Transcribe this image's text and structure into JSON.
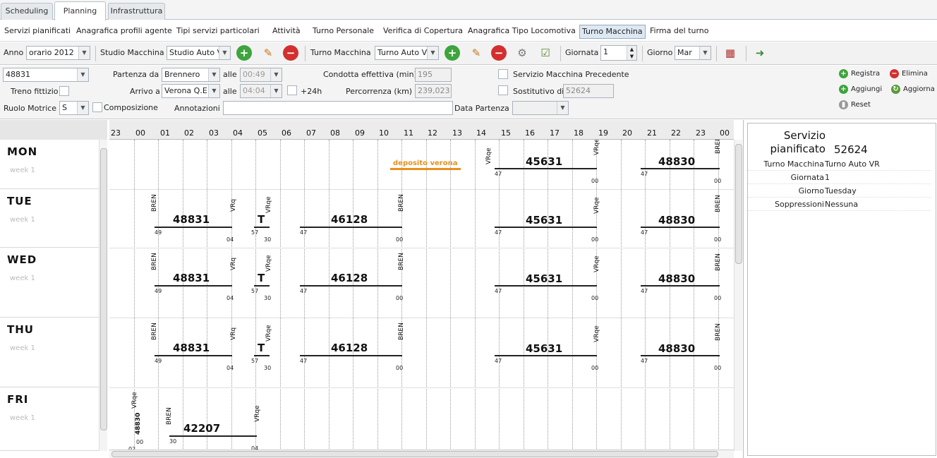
{
  "tabs": [
    "Scheduling",
    "Planning",
    "Infrastruttura"
  ],
  "menu": [
    "Servizi pianificati",
    "Anagrafica profili agente",
    "Tipi servizi particolari",
    "Attività",
    "Turno Personale",
    "Verifica di Copertura",
    "Anagrafica Tipo Locomotiva",
    "Turno Macchina",
    "Firma del turno"
  ],
  "toolbar": {
    "anno_label": "Anno",
    "anno_value": "orario 2012",
    "studio_label": "Studio Macchina",
    "studio_value": "Studio Auto V",
    "turno_label": "Turno Macchina",
    "turno_value": "Turno Auto V",
    "giornata_label": "Giornata",
    "giornata_value": "1",
    "giorno_label": "Giorno",
    "giorno_value": "Mar"
  },
  "form": {
    "train_value": "48831",
    "partenza_label": "Partenza da",
    "partenza_value": "Brennero",
    "alle1_label": "alle",
    "alle1_value": "00:49",
    "condotta_label": "Condotta effettiva (min)",
    "condotta_value": "195",
    "smp_label": "Servizio Macchina Precedente",
    "fittizio_label": "Treno fittizio",
    "arrivo_label": "Arrivo a",
    "arrivo_value": "Verona Q.E",
    "alle2_label": "alle",
    "alle2_value": "04:04",
    "plus24_label": "+24h",
    "percorrenza_label": "Percorrenza (km)",
    "percorrenza_value": "239,023",
    "sostitutivo_label": "Sostitutivo di",
    "sostitutivo_value": "52624",
    "ruolo_label": "Ruolo Motrice",
    "ruolo_value": "S",
    "composizione_label": "Composizione",
    "annotazioni_label": "Annotazioni",
    "annotazioni_value": "",
    "data_partenza_label": "Data Partenza",
    "data_partenza_value": ""
  },
  "actions": {
    "registra": "Registra",
    "elimina": "Elimina",
    "aggiungi": "Aggiungi",
    "aggiorna": "Aggiorna",
    "reset": "Reset"
  },
  "hours": [
    "23",
    "00",
    "01",
    "02",
    "03",
    "04",
    "05",
    "06",
    "07",
    "08",
    "09",
    "10",
    "11",
    "12",
    "13",
    "14",
    "15",
    "16",
    "17",
    "18",
    "19",
    "20",
    "21",
    "22",
    "23",
    "00"
  ],
  "days": [
    {
      "name": "MON",
      "week": "week 1"
    },
    {
      "name": "TUE",
      "week": "week 1"
    },
    {
      "name": "WED",
      "week": "week 1"
    },
    {
      "name": "THU",
      "week": "week 1"
    },
    {
      "name": "FRI",
      "week": "week 1"
    }
  ],
  "schedule": {
    "deposit_label": "deposito verona",
    "trains": {
      "t48831": "48831",
      "tT": "T",
      "t46128": "46128",
      "t45631": "45631",
      "t48830": "48830",
      "t42207": "42207",
      "t48830b": "48830"
    },
    "stations": {
      "bren": "BREN",
      "vrq": "VRq",
      "vrqe": "VRqe"
    },
    "times": {
      "m47": "47",
      "m00": "00",
      "m49": "49",
      "m04": "04",
      "m57": "57",
      "m30": "30",
      "m02": "02"
    }
  },
  "panel": {
    "title": "Servizio pianificato",
    "title_value": "52624",
    "rows": [
      {
        "k": "Turno Macchina",
        "v": "Turno Auto VR"
      },
      {
        "k": "Giornata",
        "v": "1"
      },
      {
        "k": "Giorno",
        "v": "Tuesday"
      },
      {
        "k": "Soppressioni",
        "v": "Nessuna"
      }
    ]
  }
}
